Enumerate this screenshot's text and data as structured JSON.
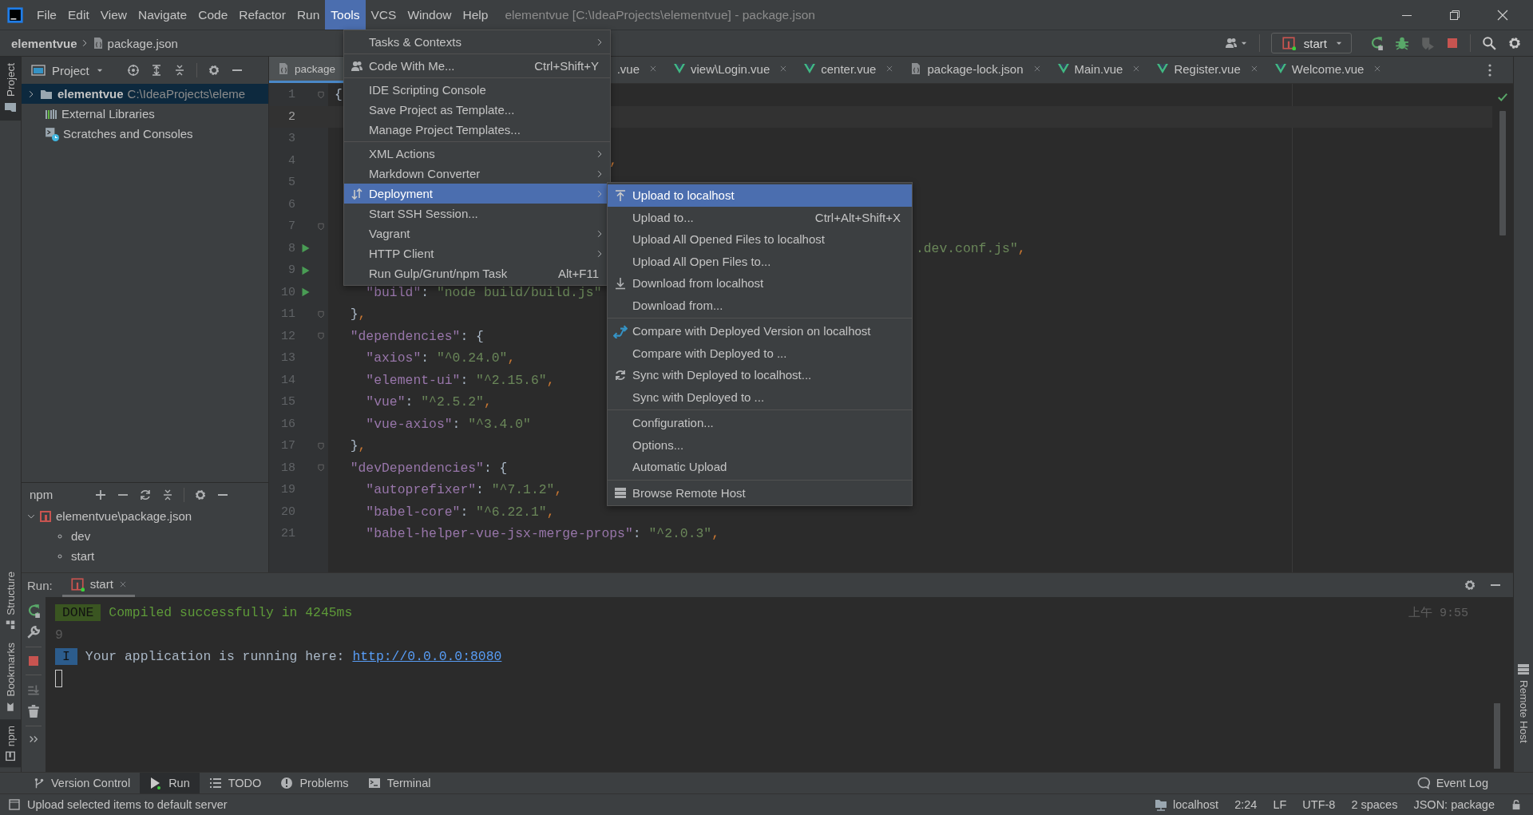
{
  "menu_bar": {
    "items": [
      {
        "label": "File",
        "selected": false
      },
      {
        "label": "Edit",
        "selected": false
      },
      {
        "label": "View",
        "selected": false
      },
      {
        "label": "Navigate",
        "selected": false
      },
      {
        "label": "Code",
        "selected": false
      },
      {
        "label": "Refactor",
        "selected": false
      },
      {
        "label": "Run",
        "selected": false
      },
      {
        "label": "Tools",
        "selected": true
      },
      {
        "label": "VCS",
        "selected": false
      },
      {
        "label": "Window",
        "selected": false
      },
      {
        "label": "Help",
        "selected": false
      }
    ],
    "title": "elementvue [C:\\IdeaProjects\\elementvue] - package.json"
  },
  "navigation_bar": {
    "breadcrumbs": [
      "elementvue",
      "package.json"
    ],
    "run_configuration": "start"
  },
  "tool_stripe_left": [
    {
      "label": "Project",
      "selected": true
    },
    {
      "label": "Structure",
      "selected": false
    },
    {
      "label": "Bookmarks",
      "selected": false
    },
    {
      "label": "npm",
      "selected": true
    }
  ],
  "project_panel": {
    "title": "Project",
    "tree": [
      {
        "label": "elementvue",
        "path": "C:\\IdeaProjects\\eleme",
        "kind": "folder",
        "selected": true
      },
      {
        "label": "External Libraries",
        "kind": "libraries",
        "selected": false
      },
      {
        "label": "Scratches and Consoles",
        "kind": "scratches",
        "selected": false
      }
    ]
  },
  "npm_panel": {
    "title": "npm",
    "tree": [
      {
        "label": "elementvue\\package.json",
        "expanded": true,
        "children": [
          {
            "label": "dev"
          },
          {
            "label": "start"
          }
        ]
      }
    ]
  },
  "editor": {
    "tabs": [
      {
        "label": "package",
        "kind": "json",
        "selected": true
      },
      {
        "label": ".vue",
        "selected": false
      },
      {
        "label": "view\\Login.vue",
        "kind": "vue",
        "selected": false
      },
      {
        "label": "center.vue",
        "kind": "vue",
        "selected": false
      },
      {
        "label": "package-lock.json",
        "kind": "json",
        "selected": false
      },
      {
        "label": "Main.vue",
        "kind": "vue",
        "selected": false
      },
      {
        "label": "Register.vue",
        "kind": "vue",
        "selected": false
      },
      {
        "label": "Welcome.vue",
        "kind": "vue",
        "selected": false
      }
    ],
    "lines": [
      {
        "number": "1",
        "code": "{",
        "kind": "fold",
        "current": false
      },
      {
        "number": "2",
        "kind": "plain",
        "current": true
      },
      {
        "number": "3",
        "kind": "plain",
        "current": false
      },
      {
        "number": "4",
        "code": "                                   ,",
        "kind": "plain",
        "current": false
      },
      {
        "number": "5",
        "kind": "plain",
        "current": false
      },
      {
        "number": "6",
        "kind": "plain",
        "current": false
      },
      {
        "number": "7",
        "kind": "fold",
        "current": false
      },
      {
        "number": "8",
        "code": "                                                                          .dev.conf.js\",",
        "kind": "run",
        "current": false
      },
      {
        "number": "9",
        "kind": "run",
        "current": false
      },
      {
        "number": "10",
        "code": "    \"build\": \"node build/build.js\"",
        "kind": "run",
        "current": false
      },
      {
        "number": "11",
        "code": "  },",
        "kind": "fold",
        "current": false
      },
      {
        "number": "12",
        "code": "  \"dependencies\": {",
        "kind": "fold",
        "current": false
      },
      {
        "number": "13",
        "code": "    \"axios\": \"^0.24.0\",",
        "kind": "plain",
        "current": false
      },
      {
        "number": "14",
        "code": "    \"element-ui\": \"^2.15.6\",",
        "kind": "plain",
        "current": false
      },
      {
        "number": "15",
        "code": "    \"vue\": \"^2.5.2\",",
        "kind": "plain",
        "current": false
      },
      {
        "number": "16",
        "code": "    \"vue-axios\": \"^3.4.0\"",
        "kind": "plain",
        "current": false
      },
      {
        "number": "17",
        "code": "  },",
        "kind": "fold",
        "current": false
      },
      {
        "number": "18",
        "code": "  \"devDependencies\": {",
        "kind": "fold",
        "current": false
      },
      {
        "number": "19",
        "code": "    \"autoprefixer\": \"^7.1.2\",",
        "kind": "plain",
        "current": false
      },
      {
        "number": "20",
        "code": "    \"babel-core\": \"^6.22.1\",",
        "kind": "plain",
        "current": false
      },
      {
        "number": "21",
        "code": "    \"babel-helper-vue-jsx-merge-props\": \"^2.0.3\",",
        "kind": "plain",
        "current": false
      }
    ]
  },
  "tools_menu": {
    "groups": [
      [
        {
          "label": "Tasks & Contexts",
          "kind": "submenu",
          "selected": false
        }
      ],
      [
        {
          "label": "Code With Me...",
          "shortcut": "Ctrl+Shift+Y",
          "kind": "action",
          "selected": false
        }
      ],
      [
        {
          "label": "IDE Scripting Console",
          "kind": "action",
          "selected": false
        },
        {
          "label": "Save Project as Template...",
          "kind": "action",
          "selected": false
        },
        {
          "label": "Manage Project Templates...",
          "kind": "action",
          "selected": false
        }
      ],
      [
        {
          "label": "XML Actions",
          "kind": "submenu",
          "selected": false
        },
        {
          "label": "Markdown Converter",
          "kind": "submenu",
          "selected": false
        },
        {
          "label": "Deployment",
          "kind": "submenu",
          "selected": true
        },
        {
          "label": "Start SSH Session...",
          "kind": "action",
          "selected": false
        },
        {
          "label": "Vagrant",
          "kind": "submenu",
          "selected": false
        },
        {
          "label": "HTTP Client",
          "kind": "submenu",
          "selected": false
        },
        {
          "label": "Run Gulp/Grunt/npm Task",
          "shortcut": "Alt+F11",
          "kind": "action",
          "selected": false
        }
      ]
    ]
  },
  "deployment_submenu": {
    "groups": [
      [
        {
          "label": "Upload to localhost",
          "selected": true
        },
        {
          "label": "Upload to...",
          "shortcut": "Ctrl+Alt+Shift+X",
          "selected": false
        },
        {
          "label": "Upload All Opened Files to localhost",
          "selected": false
        },
        {
          "label": "Upload All Open Files to...",
          "selected": false
        },
        {
          "label": "Download from localhost",
          "selected": false
        },
        {
          "label": "Download from...",
          "selected": false
        }
      ],
      [
        {
          "label": "Compare with Deployed Version on localhost",
          "selected": false
        },
        {
          "label": "Compare with Deployed to ...",
          "selected": false
        },
        {
          "label": "Sync with Deployed to localhost...",
          "selected": false
        },
        {
          "label": "Sync with Deployed to ...",
          "selected": false
        }
      ],
      [
        {
          "label": "Configuration...",
          "selected": false
        },
        {
          "label": "Options...",
          "selected": false
        },
        {
          "label": "Automatic Upload",
          "selected": false
        }
      ],
      [
        {
          "label": "Browse Remote Host",
          "selected": false
        }
      ]
    ]
  },
  "run_panel": {
    "title": "Run:",
    "tabs": [
      {
        "label": "start",
        "selected": true
      }
    ],
    "console": [
      {
        "kind": "status",
        "badge": "DONE",
        "text": "Compiled successfully in 4245ms",
        "time": "上午 9:55"
      },
      {
        "kind": "plain",
        "text": "9"
      },
      {
        "kind": "info",
        "badge": "I",
        "text": "Your application is running here:",
        "link": "http://0.0.0.0:8080"
      },
      {
        "kind": "cursor"
      }
    ]
  },
  "tool_window_bar": {
    "items": [
      {
        "label": "Version Control",
        "selected": false
      },
      {
        "label": "Run",
        "selected": true
      },
      {
        "label": "TODO",
        "selected": false
      },
      {
        "label": "Problems",
        "selected": false
      },
      {
        "label": "Terminal",
        "selected": false
      }
    ],
    "event_log": "Event Log"
  },
  "tool_stripe_right": [
    {
      "label": "Remote Host",
      "selected": false
    }
  ],
  "status_bar": {
    "message": "Upload selected items to default server",
    "widgets": [
      "localhost",
      "2:24",
      "LF",
      "UTF-8",
      "2 spaces",
      "JSON: package"
    ]
  }
}
